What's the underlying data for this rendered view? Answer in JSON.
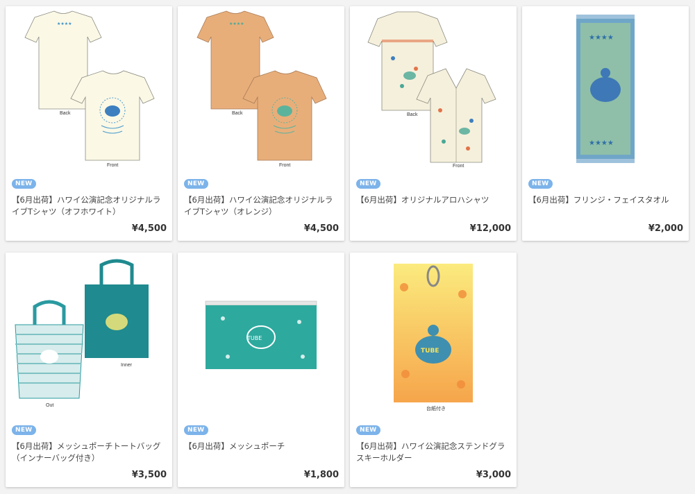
{
  "products": [
    {
      "badge": "NEW",
      "name": "【6月出荷】ハワイ公演記念オリジナルライブTシャツ（オフホワイト）",
      "price": "¥4,500",
      "image": "tshirt-offwhite-image",
      "captions": [
        "Back",
        "Front"
      ]
    },
    {
      "badge": "NEW",
      "name": "【6月出荷】ハワイ公演記念オリジナルライブTシャツ（オレンジ）",
      "price": "¥4,500",
      "image": "tshirt-orange-image",
      "captions": [
        "Back",
        "Front"
      ]
    },
    {
      "badge": "NEW",
      "name": "【6月出荷】オリジナルアロハシャツ",
      "price": "¥12,000",
      "image": "aloha-shirt-image",
      "captions": [
        "Back",
        "Front"
      ]
    },
    {
      "badge": "NEW",
      "name": "【6月出荷】フリンジ・フェイスタオル",
      "price": "¥2,000",
      "image": "face-towel-image",
      "captions": []
    },
    {
      "badge": "NEW",
      "name": "【6月出荷】メッシュポーチトートバッグ（インナーバッグ付き）",
      "price": "¥3,500",
      "image": "tote-bag-image",
      "captions": [
        "Inner",
        "Out"
      ]
    },
    {
      "badge": "NEW",
      "name": "【6月出荷】メッシュポーチ",
      "price": "¥1,800",
      "image": "mesh-pouch-image",
      "captions": []
    },
    {
      "badge": "NEW",
      "name": "【6月出荷】ハワイ公演記念ステンドグラスキーホルダー",
      "price": "¥3,000",
      "image": "keyholder-image",
      "captions": [
        "台紙付き"
      ]
    }
  ],
  "colors": {
    "badge": "#7cb3ea",
    "card": "#ffffff",
    "background": "#f3f3f3"
  }
}
